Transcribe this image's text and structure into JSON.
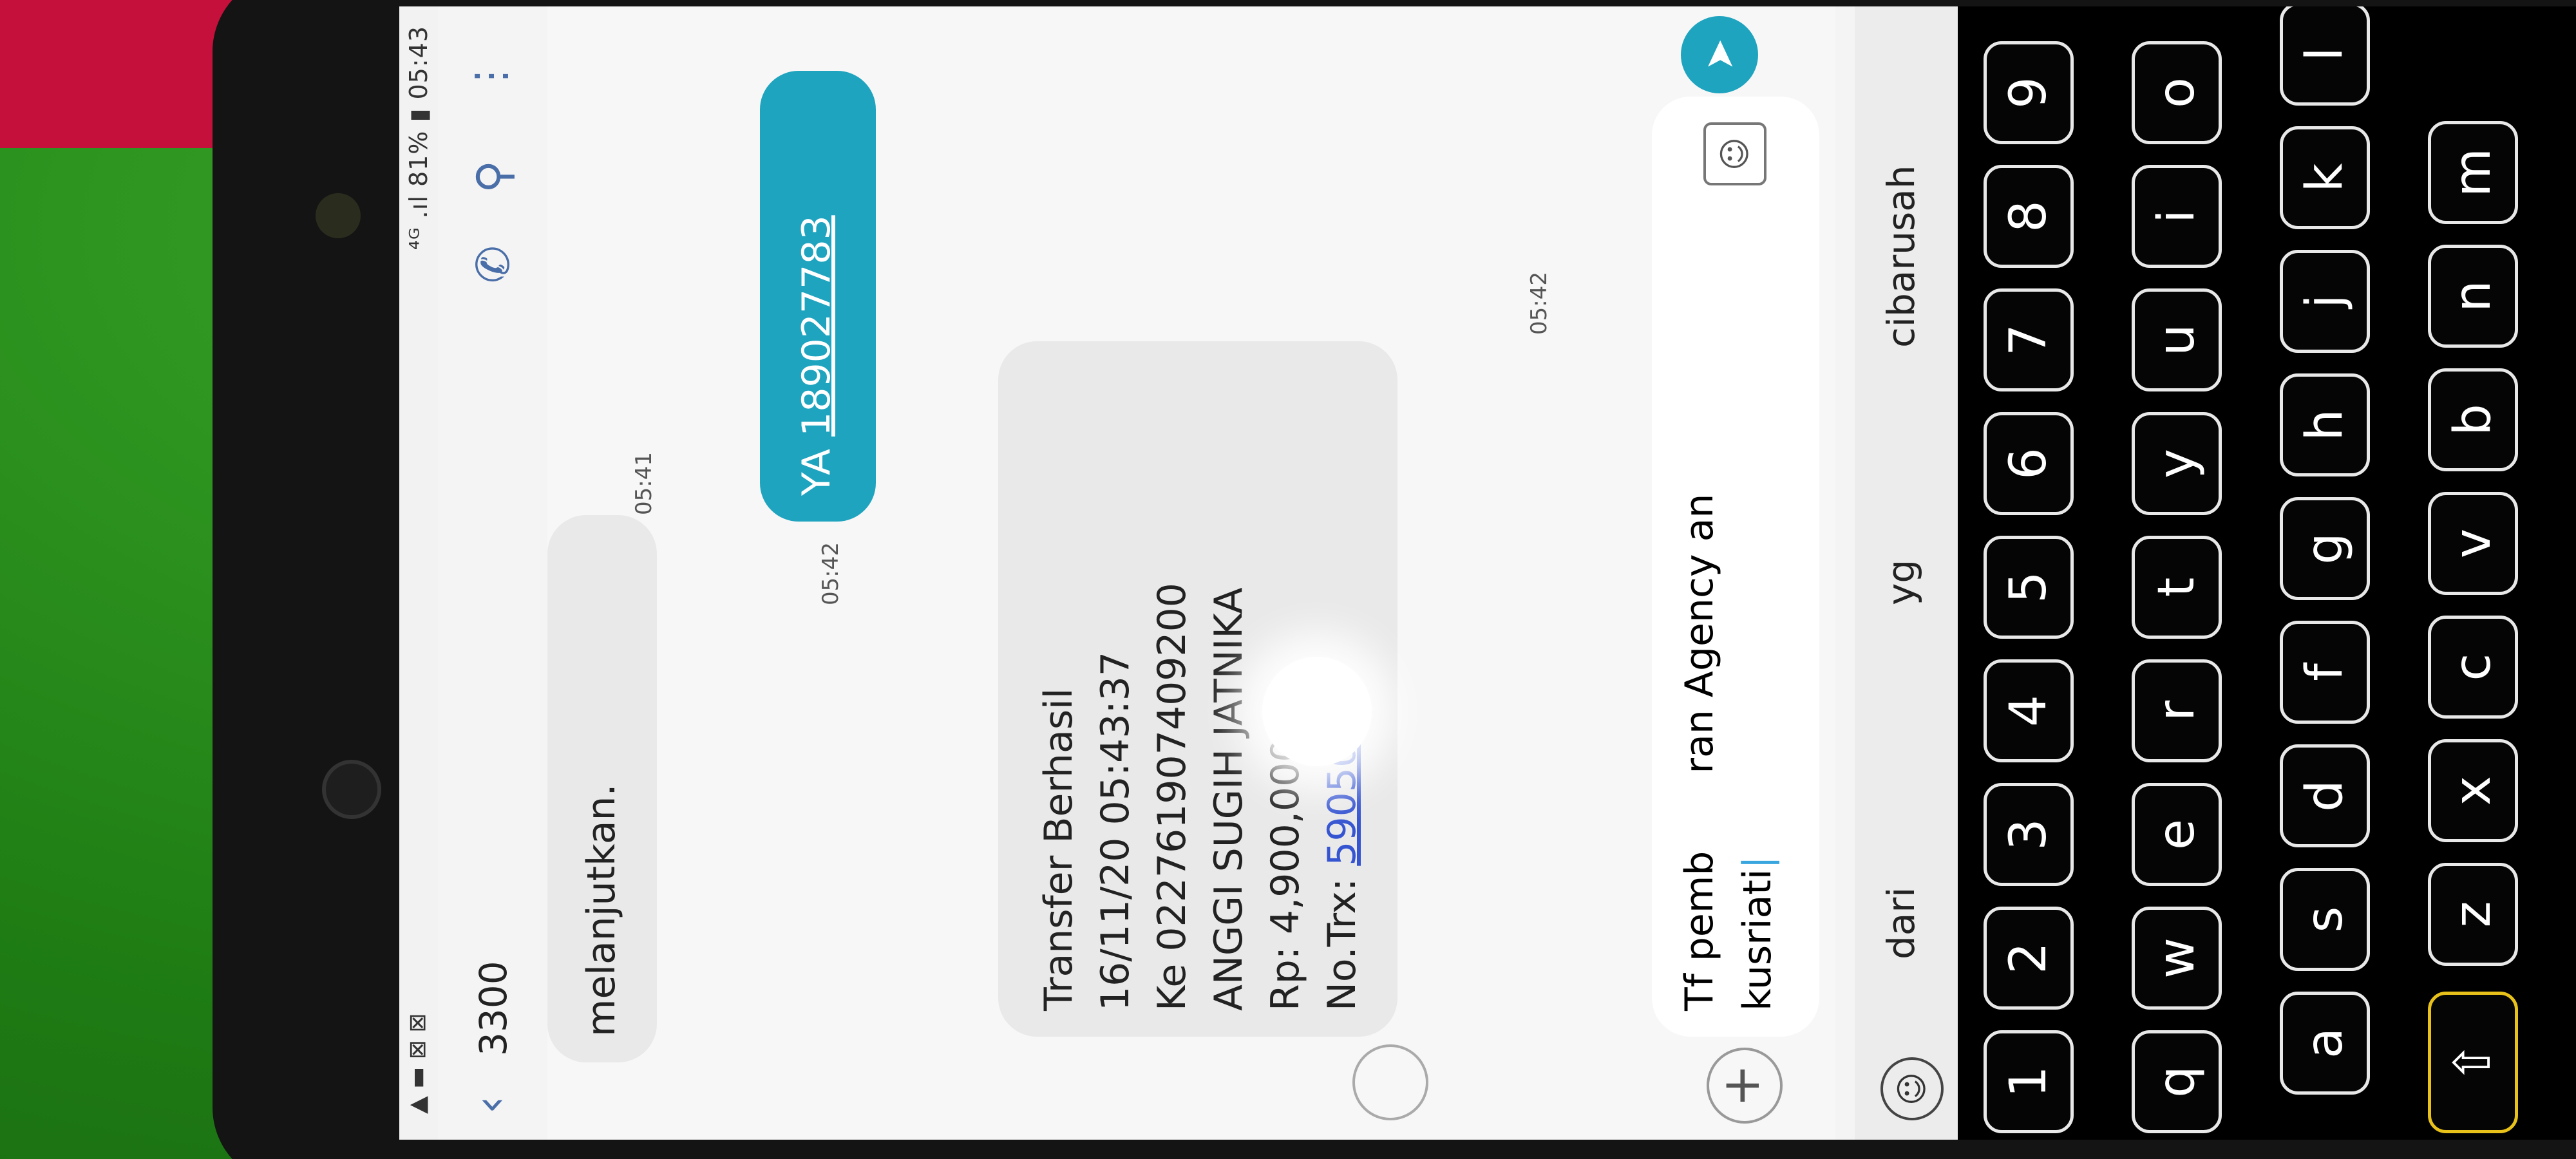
{
  "status_bar": {
    "left_icons": "▲ ▬ ⊠ ⊠",
    "right": "⁴ᴳ .ıl 81% ▮ 05:43"
  },
  "header": {
    "back_icon": "chevron-left-icon",
    "contact": "3300",
    "call_icon": "phone-icon",
    "search_icon": "search-icon",
    "more_icon": "more-vertical-icon"
  },
  "messages": {
    "prev_in": {
      "text": "melanjutkan.",
      "time": "05:41"
    },
    "out": {
      "prefix": "YA ",
      "link": "189027783",
      "time": "05:42"
    },
    "in": {
      "lines": [
        "Transfer Berhasil",
        "16/11/20 05:43:37",
        "Ke 02276190740920​0",
        "ANGGI SUGIH JATNIKA",
        "Rp: 4,900,000"
      ],
      "trx_label": "No.Trx: ",
      "trx_link": "590505",
      "time": "05:42"
    }
  },
  "composer": {
    "text_line1": "Tf pemb",
    "text_line1b": "ran Agency an",
    "text_line2": "kusriati",
    "add_icon": "plus-icon",
    "sticker_icon": "sticker-icon",
    "send_icon": "send-icon"
  },
  "suggestions": [
    "dari",
    "yg",
    "cibarusah"
  ],
  "keyboard": {
    "row1": [
      "1",
      "2",
      "3",
      "4",
      "5",
      "6",
      "7",
      "8",
      "9"
    ],
    "row2": [
      "q",
      "w",
      "e",
      "r",
      "t",
      "y",
      "u",
      "i",
      "o"
    ],
    "row3": [
      "a",
      "s",
      "d",
      "f",
      "g",
      "h",
      "j",
      "k",
      "l"
    ],
    "row4": [
      "⇧",
      "z",
      "x",
      "c",
      "v",
      "b",
      "n",
      "m"
    ]
  }
}
